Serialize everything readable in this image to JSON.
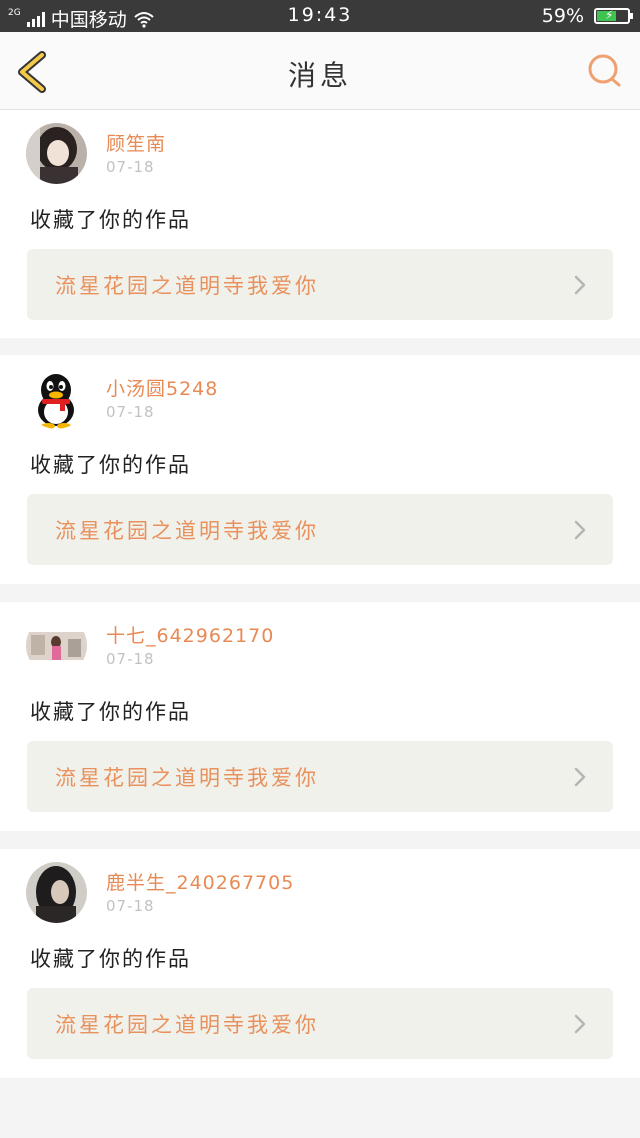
{
  "status_bar": {
    "network": "2G",
    "carrier": "中国移动",
    "time": "19:43",
    "battery": "59%"
  },
  "header": {
    "title": "消息"
  },
  "colors": {
    "accent": "#e88a55",
    "back_icon": "#f2c94c",
    "card_bg": "#ffffff",
    "work_bg": "#f1f1ec"
  },
  "messages": [
    {
      "username": "顾笙南",
      "date": "07-18",
      "action": "收藏了你的作品",
      "work_title": "流星花园之道明寺我爱你",
      "avatar_icon": "photo-girl-avatar"
    },
    {
      "username": "小汤圆5248",
      "date": "07-18",
      "action": "收藏了你的作品",
      "work_title": "流星花园之道明寺我爱你",
      "avatar_icon": "penguin-avatar"
    },
    {
      "username": "十七_642962170",
      "date": "07-18",
      "action": "收藏了你的作品",
      "work_title": "流星花园之道明寺我爱你",
      "avatar_icon": "photo-room-avatar"
    },
    {
      "username": "鹿半生_240267705",
      "date": "07-18",
      "action": "收藏了你的作品",
      "work_title": "流星花园之道明寺我爱你",
      "avatar_icon": "photo-dark-avatar"
    }
  ]
}
